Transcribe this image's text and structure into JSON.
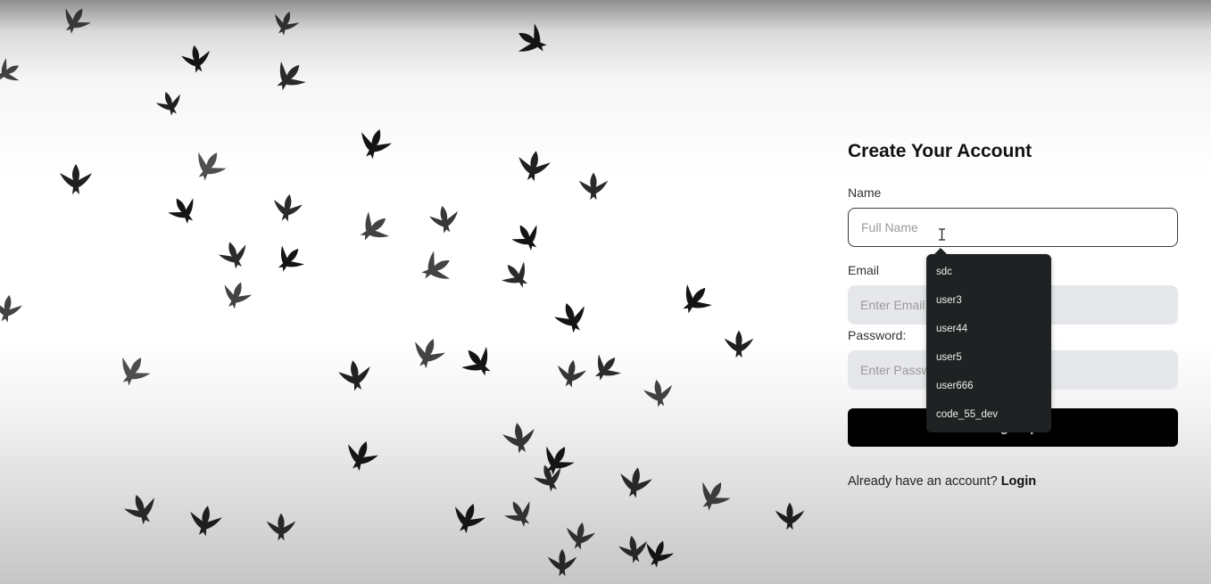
{
  "background": {
    "description_icon": "flock-of-birds-image"
  },
  "form": {
    "title": "Create Your Account",
    "name_label": "Name",
    "name_placeholder": "Full Name",
    "email_label": "Email",
    "email_placeholder": "Enter Email",
    "password_label": "Password:",
    "password_placeholder": "Enter Password",
    "submit_label": "Sign Up",
    "login_prompt": "Already have an account?",
    "login_link": "Login"
  },
  "autocomplete": {
    "items": [
      "sdc",
      "user3",
      "user44",
      "user5",
      "user666",
      "code_55_dev"
    ]
  },
  "colors": {
    "button_bg": "#000000",
    "input_bg": "#e6e7ea",
    "dropdown_bg": "#1e2222"
  }
}
